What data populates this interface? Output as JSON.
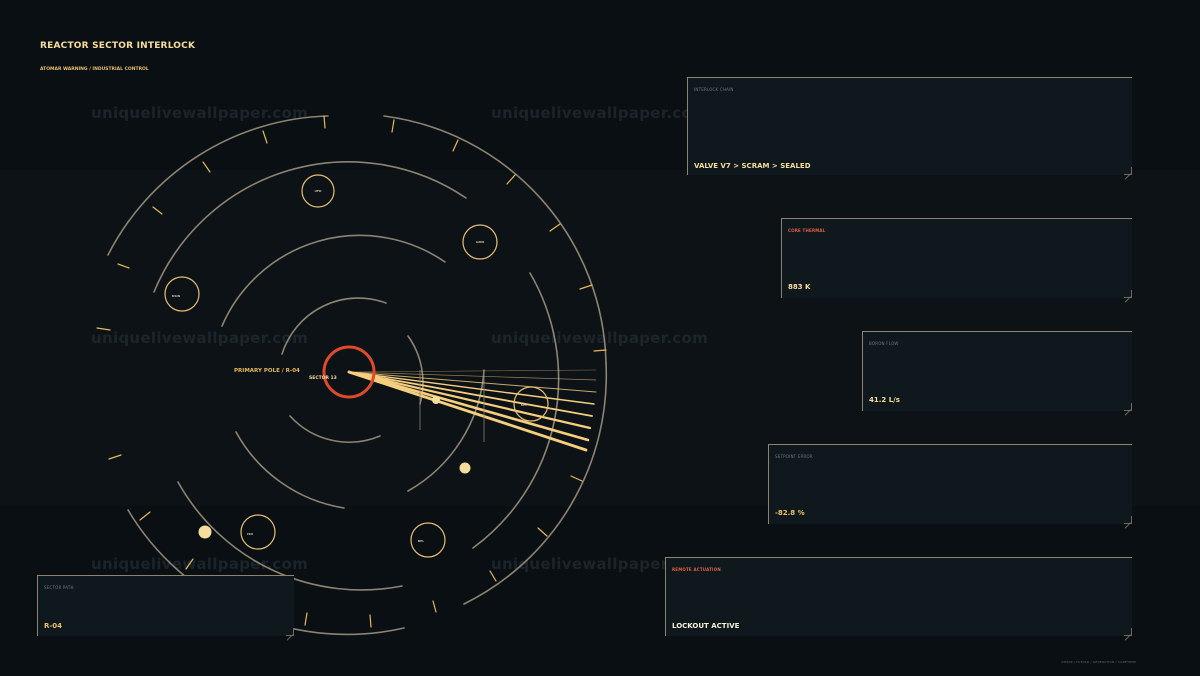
{
  "header": {
    "title": "REACTOR SECTOR INTERLOCK",
    "subtitle": "ATOMAR WARNING / INDUSTRIAL CONTROL"
  },
  "watermark": "uniquelivewallpaper.com",
  "diagram": {
    "primary_label": "PRIMARY POLE / R-04",
    "center_label": "SECTOR 13",
    "node_labels": [
      "UFD",
      "GMN",
      "DSIN",
      "SEC",
      "ISN",
      "BEL"
    ],
    "colors": {
      "ring": "#8c8472",
      "tick": "#e8b95a",
      "node": "#e8c070",
      "core": "#e04a2a",
      "beam": "#f6cf7e"
    }
  },
  "panels": {
    "interlock": {
      "label": "INTERLOCK CHAIN",
      "value": "VALVE V7 > SCRAM > SEALED"
    },
    "thermal": {
      "label": "CORE THERMAL",
      "value": "883 K"
    },
    "boron": {
      "label": "BORON FLOW",
      "value": "41.2 L/s"
    },
    "setpoint": {
      "label": "SETPOINT ERROR",
      "value": "-82.8 %"
    },
    "remote": {
      "label": "REMOTE ACTUATION",
      "value": "LOCKOUT ACTIVE"
    },
    "sector": {
      "label": "SECTOR PATH",
      "value": "R-04"
    }
  },
  "footer": "ATMAR / FUELRD / GENERATION / CORETEMP"
}
